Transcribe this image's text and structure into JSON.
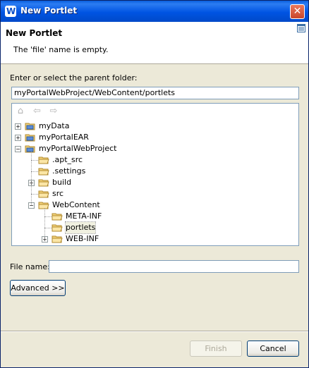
{
  "window": {
    "title": "New Portlet",
    "close_glyph": "✕"
  },
  "header": {
    "title": "New Portlet",
    "message": "The 'file' name is empty."
  },
  "folder_section": {
    "label": "Enter or select the parent folder:",
    "path_value": "myPortalWebProject/WebContent/portlets"
  },
  "tree_toolbar": {
    "home": "⌂",
    "back": "⇦",
    "forward": "⇨"
  },
  "tree": {
    "items": [
      {
        "label": "myData",
        "expander": "+"
      },
      {
        "label": "myPortalEAR",
        "expander": "+"
      },
      {
        "label": "myPortalWebProject",
        "expander": "−"
      },
      {
        "label": ".apt_src"
      },
      {
        "label": ".settings"
      },
      {
        "label": "build",
        "expander": "+"
      },
      {
        "label": "src"
      },
      {
        "label": "WebContent",
        "expander": "−"
      },
      {
        "label": "META-INF"
      },
      {
        "label": "portlets"
      },
      {
        "label": "WEB-INF",
        "expander": "+"
      }
    ]
  },
  "file_name": {
    "label": "File name:",
    "value": ""
  },
  "buttons": {
    "advanced": "Advanced >>",
    "finish": "Finish",
    "cancel": "Cancel"
  },
  "colors": {
    "titlebar": "#0054E3",
    "dialog_bg": "#ECE9D8",
    "folder": "#F4D37A"
  }
}
